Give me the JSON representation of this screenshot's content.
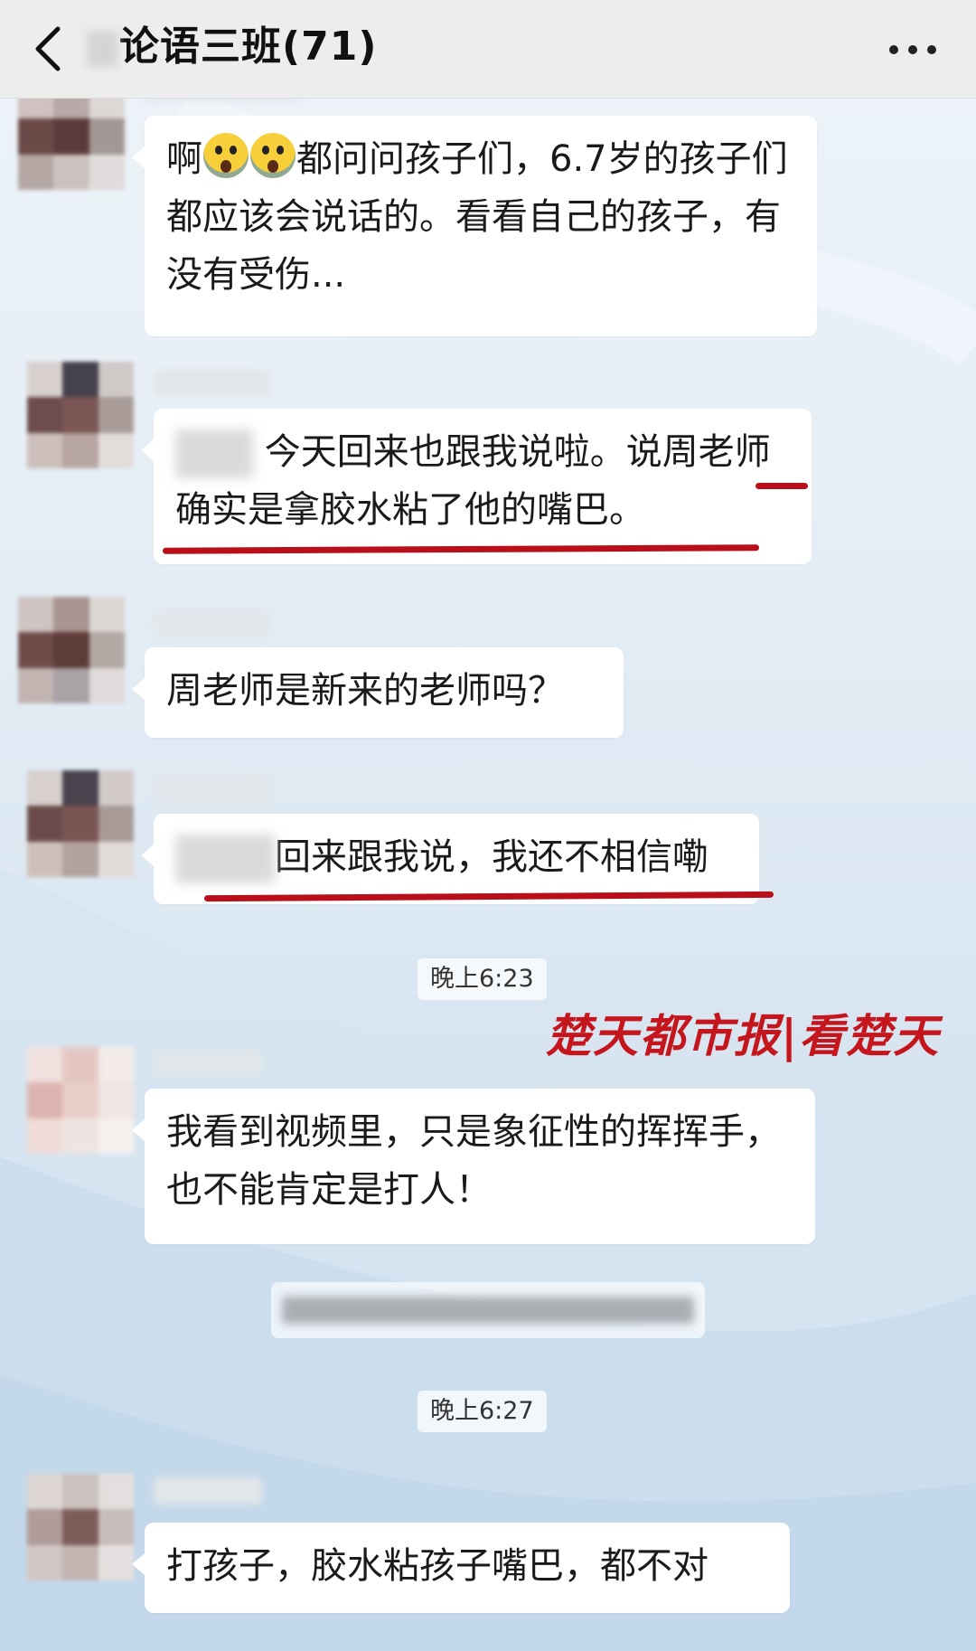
{
  "header": {
    "title": "论语三班(71)"
  },
  "watermark": "楚天都市报|看楚天",
  "messages": [
    {
      "text_parts": [
        "啊",
        "都问问孩子们，6.7岁的孩子们都应该会说话的。看看自己的孩子，有没有受伤..."
      ]
    },
    {
      "text": "今天回来也跟我说啦。说周老师确实是拿胶水粘了他的嘴巴。"
    },
    {
      "text": "周老师是新来的老师吗？"
    },
    {
      "text": "回来跟我说，我还不相信嘞"
    },
    {
      "text": "我看到视频里，只是象征性的挥挥手，也不能肯定是打人！"
    },
    {
      "text": "打孩子，胶水粘孩子嘴巴，都不对"
    }
  ],
  "timestamps": [
    "晚上6:23",
    "晚上6:27"
  ],
  "colors": {
    "underline": "#b80f1b",
    "watermark": "#c4161c",
    "bubble": "#ffffff",
    "topbar": "#ededed"
  },
  "icons": [
    "back-chevron-icon",
    "more-dots-icon",
    "scream-emoji-icon"
  ]
}
